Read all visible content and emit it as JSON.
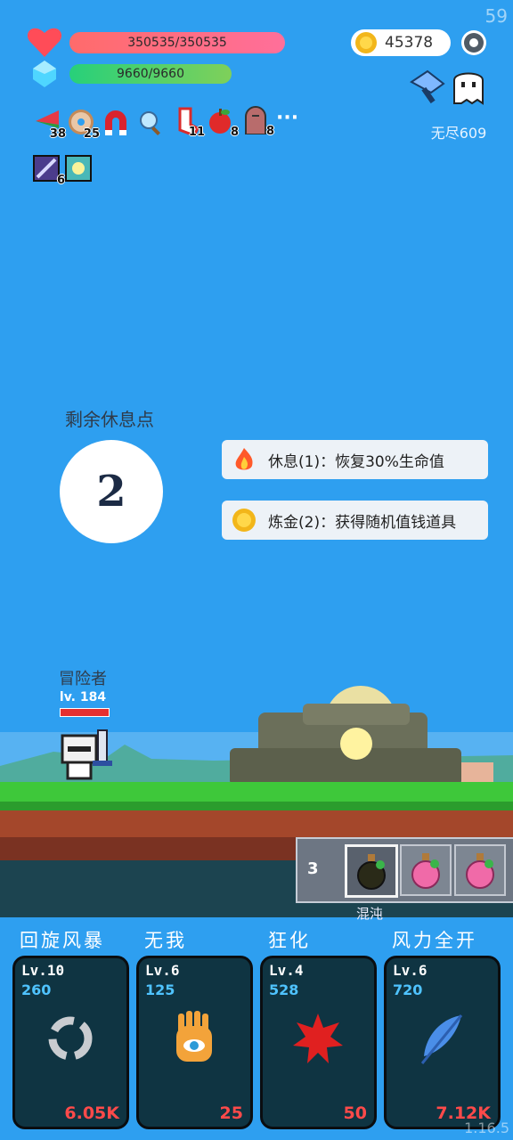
{
  "fps": "59",
  "player": {
    "hp_text": "350535/350535",
    "mp_text": "9660/9660"
  },
  "coins": "45378",
  "mode": "无尽609",
  "items": [
    {
      "icon": "watermelon-icon",
      "count": "38"
    },
    {
      "icon": "donut-icon",
      "count": "25"
    },
    {
      "icon": "magnet-icon",
      "count": ""
    },
    {
      "icon": "magnifier-icon",
      "count": ""
    },
    {
      "icon": "sock-icon",
      "count": "11"
    },
    {
      "icon": "apple-icon",
      "count": "8"
    },
    {
      "icon": "tombstone-icon",
      "count": "8"
    },
    {
      "icon": "more-icon",
      "label": "···"
    }
  ],
  "items_row2": [
    {
      "icon": "scroll-icon",
      "count": "6"
    },
    {
      "icon": "sparkle-icon",
      "count": ""
    }
  ],
  "rest": {
    "title": "剩余休息点",
    "points": "2",
    "options": [
      {
        "icon": "fire-icon",
        "label": "休息(1)：恢复30%生命值"
      },
      {
        "icon": "coin-icon",
        "label": "炼金(2)：获得随机值钱道具"
      }
    ]
  },
  "hero": {
    "name": "冒险者",
    "level": "lv. 184"
  },
  "potions": {
    "count": "3",
    "selected_label": "混沌"
  },
  "skills": [
    {
      "name": "回旋风暴",
      "level": "Lv.10",
      "mana": "260",
      "cost": "6.05K",
      "icon": "whirlwind-icon"
    },
    {
      "name": "无我",
      "level": "Lv.6",
      "mana": "125",
      "cost": "25",
      "icon": "eye-hand-icon"
    },
    {
      "name": "狂化",
      "level": "Lv.4",
      "mana": "528",
      "cost": "50",
      "icon": "rage-splash-icon"
    },
    {
      "name": "风力全开",
      "level": "Lv.6",
      "mana": "720",
      "cost": "7.12K",
      "icon": "feather-icon"
    }
  ],
  "version": "1.16.5",
  "colors": {
    "sky": "#2e9ff0",
    "hp": "#ff6b6b",
    "mp": "#27d07a",
    "skill_cost": "#ff4a4a",
    "skill_mana": "#4fc3ff"
  }
}
